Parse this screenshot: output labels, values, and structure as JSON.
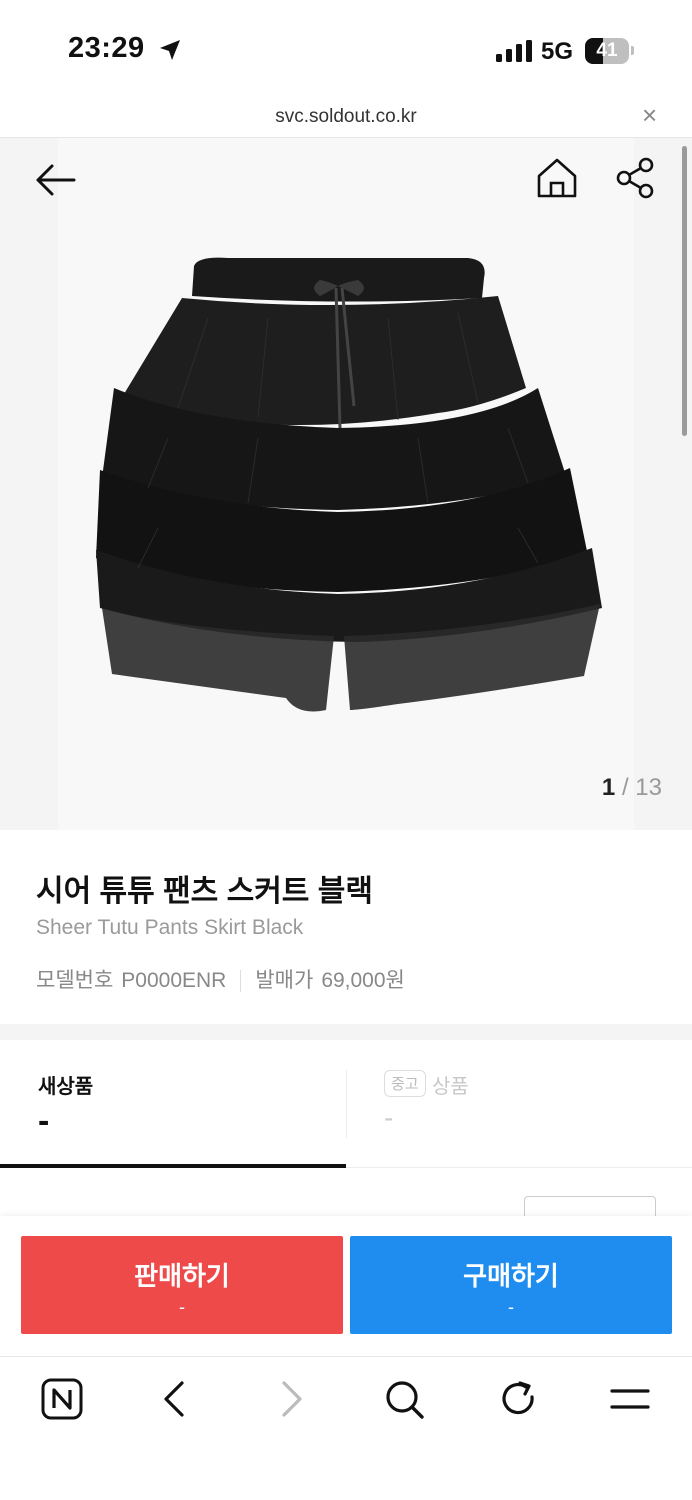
{
  "status_bar": {
    "time": "23:29",
    "network": "5G",
    "battery_level": "41",
    "battery_fraction": 0.41
  },
  "browser": {
    "url": "svc.soldout.co.kr",
    "close_icon": "close-icon"
  },
  "gallery": {
    "current": "1",
    "separator": "/",
    "total": "13",
    "image_icon": "tutu-skirt-product-image"
  },
  "product": {
    "name_ko": "시어 튜튜 팬츠 스커트 블랙",
    "name_en": "Sheer Tutu Pants Skirt Black",
    "model_label": "모델번호",
    "model_value": "P0000ENR",
    "release_price_label": "발매가",
    "release_price_value": "69,000원"
  },
  "tabs": {
    "new": {
      "label": "새상품",
      "price": "-"
    },
    "used": {
      "badge": "중고",
      "label": "상품",
      "price": "-"
    }
  },
  "actions": {
    "sell": {
      "label": "판매하기",
      "sub": "-"
    },
    "buy": {
      "label": "구매하기",
      "sub": "-"
    }
  },
  "colors": {
    "sell": "#ef4a4a",
    "buy": "#1f8cf0"
  }
}
